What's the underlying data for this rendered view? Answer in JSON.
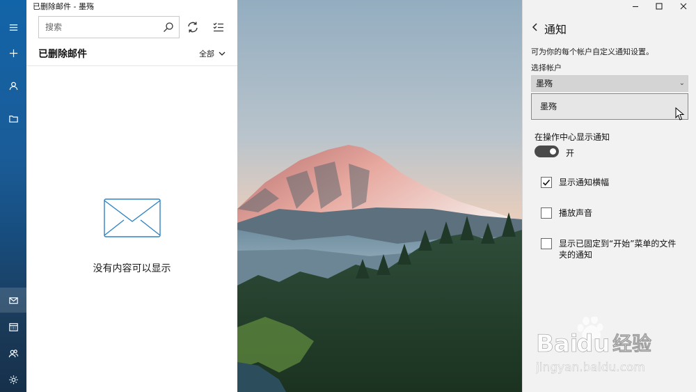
{
  "window": {
    "title": "已删除邮件 - 墨殇"
  },
  "rail": {
    "items": [
      {
        "icon": "menu-icon"
      },
      {
        "icon": "plus-icon"
      },
      {
        "icon": "person-icon"
      },
      {
        "icon": "folder-icon"
      },
      {
        "icon": "mail-icon"
      },
      {
        "icon": "calendar-icon"
      },
      {
        "icon": "people-icon"
      },
      {
        "icon": "settings-icon"
      }
    ]
  },
  "list": {
    "search_placeholder": "搜索",
    "folder_title": "已删除邮件",
    "filter_label": "全部",
    "empty_text": "没有内容可以显示"
  },
  "notifications": {
    "title": "通知",
    "description": "可为你的每个帐户自定义通知设置。",
    "account_label": "选择帐户",
    "selected_account": "墨殇",
    "dropdown_options": [
      "墨殇"
    ],
    "action_center_label": "在操作中心显示通知",
    "toggle_state": "开",
    "toggle_on": true,
    "checkboxes": [
      {
        "label": "显示通知横幅",
        "checked": true
      },
      {
        "label": "播放声音",
        "checked": false
      },
      {
        "label": "显示已固定到“开始”菜单的文件夹的通知",
        "checked": false
      }
    ]
  },
  "watermark": {
    "brand": "Bai",
    "brand_suffix": "du",
    "cn": "经验",
    "url": "jingyan.baidu.com"
  },
  "colors": {
    "accent": "#1264a8",
    "flyout_bg": "#f2f2f2",
    "toggle_bg": "#4a4a4a"
  }
}
